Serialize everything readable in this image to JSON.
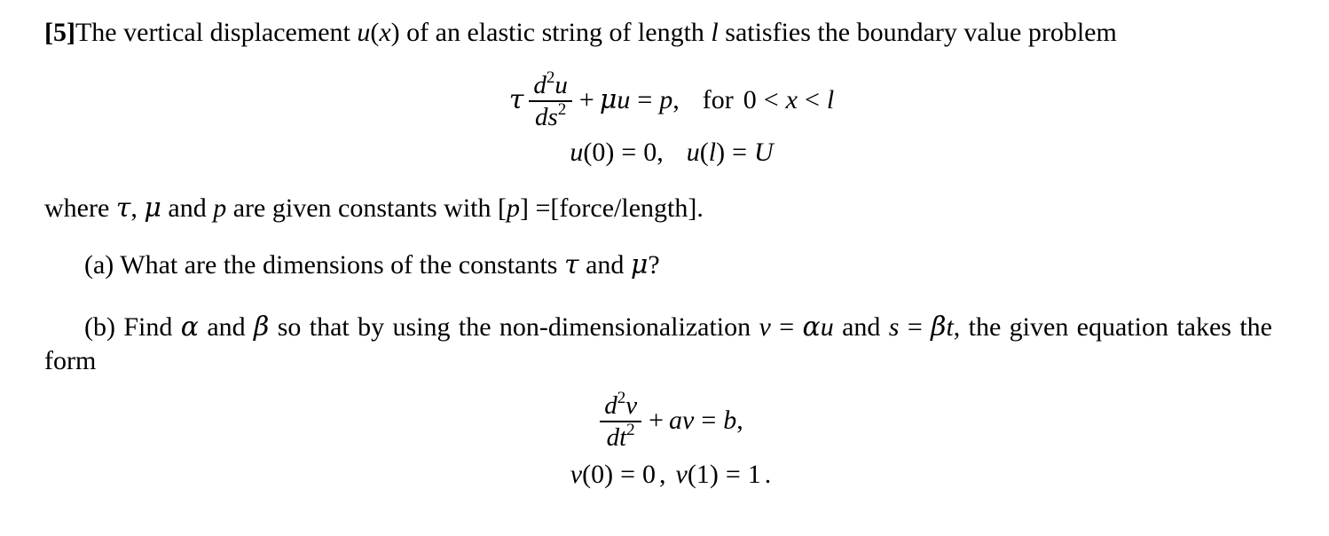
{
  "document": {
    "problem_number": "[5]",
    "background_color": "#ffffff",
    "text_color": "#000000"
  },
  "intro": {
    "t1": "The vertical displacement ",
    "u": "u",
    "paren_open": "(",
    "x": "x",
    "paren_close": ")",
    "t2": " of an elastic string of length ",
    "l": "l",
    "t3": " satisfies the boundary value problem"
  },
  "equation_governing": {
    "tau": "τ",
    "numerator": "d",
    "num_exp": "2",
    "num_var": "u",
    "denominator": "d",
    "den_var": "s",
    "den_exp": "2",
    "plus": "+",
    "mu": "μ",
    "mu_var": "u",
    "equals": "=",
    "rhs": "p",
    "comma": ",",
    "for": "for",
    "zero": "0",
    "lt1": "<",
    "x": "x",
    "lt2": "<",
    "l": "l"
  },
  "equation_boundary": {
    "u1": "u",
    "arg1": "(0)",
    "eq1": "=",
    "val1": "0",
    "comma": ",",
    "u2": "u",
    "arg2_open": "(",
    "arg2_var": "l",
    "arg2_close": ")",
    "eq2": "=",
    "val2": "U"
  },
  "where_clause": {
    "t1": "where ",
    "tau": "τ",
    "c1": ", ",
    "mu": "μ",
    "t2": " and ",
    "p": "p",
    "t3": " are given constants with ",
    "bracket_open": "[",
    "p2": "p",
    "bracket_close": "]",
    "equals": " =",
    "units": "[force/length]."
  },
  "part_a": {
    "label": "(a)",
    "t1": " What are the dimensions of the constants ",
    "tau": "τ",
    "t2": " and ",
    "mu": "μ",
    "t3": "?"
  },
  "part_b": {
    "label": "(b)",
    "t1": " Find ",
    "alpha": "α",
    "t2": " and ",
    "beta": "β",
    "t3": " so that by using the non-dimensionalization ",
    "v": "v",
    "eq1": "=",
    "alpha2": "α",
    "u": "u",
    "t4": " and ",
    "s": "s",
    "eq2": "=",
    "beta2": "β",
    "t_var": "t",
    "comma": ",",
    "t5": " the given equation takes the form"
  },
  "equation_target": {
    "numerator": "d",
    "num_exp": "2",
    "num_var": "v",
    "denominator": "d",
    "den_var": "t",
    "den_exp": "2",
    "plus": "+",
    "a": "a",
    "v": "v",
    "equals": "=",
    "rhs": "b",
    "comma": ","
  },
  "equation_target_bc": {
    "v1": "v",
    "arg1": "(0)",
    "eq1": "=",
    "val1": "0",
    "comma": ",",
    "v2": "v",
    "arg2": "(1)",
    "eq2": "=",
    "val2": "1",
    "period": "."
  }
}
